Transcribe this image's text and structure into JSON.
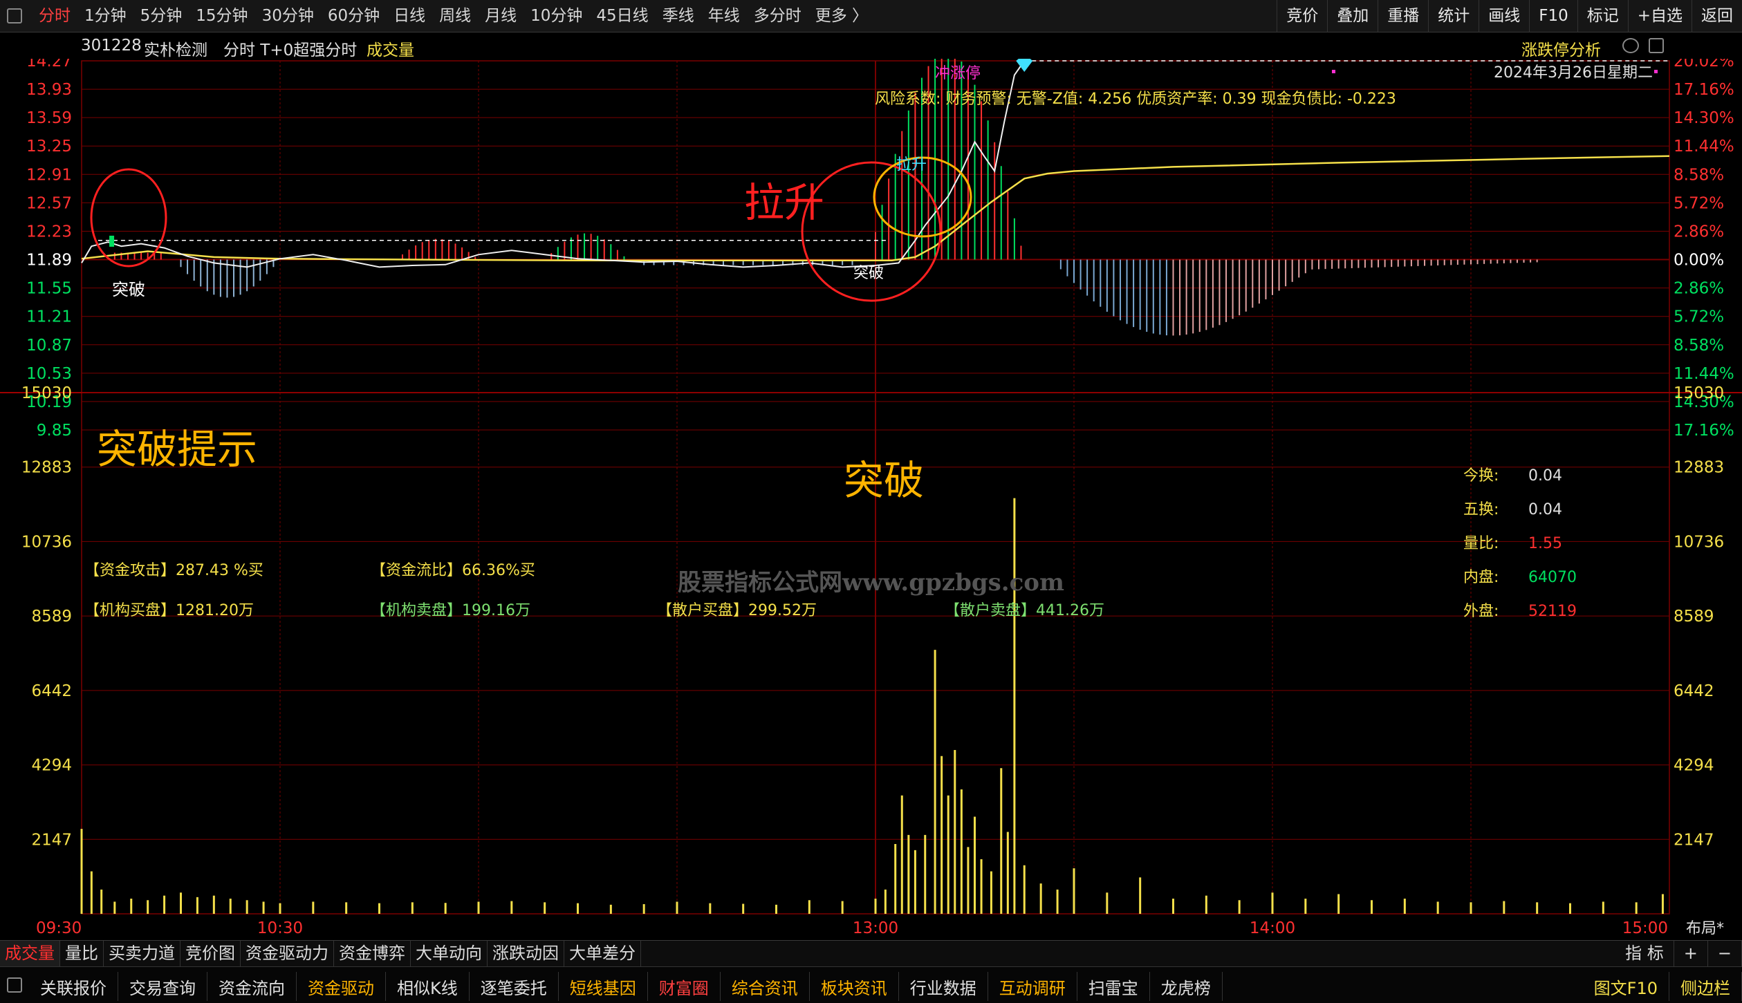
{
  "colors": {
    "up": "#ff3030",
    "down": "#00e060",
    "yellow": "#f5e04a",
    "white": "#f0f0f0",
    "grid": "#7a0000",
    "annot_orange": "#ffb400",
    "annot_red": "#ff2020",
    "cyan": "#40e0ff",
    "magenta": "#ff2fd0"
  },
  "toolbar": {
    "timeframes": [
      "分时",
      "1分钟",
      "5分钟",
      "15分钟",
      "30分钟",
      "60分钟",
      "日线",
      "周线",
      "月线",
      "10分钟",
      "45日线",
      "季线",
      "年线",
      "多分时",
      "更多 〉"
    ],
    "right": [
      "竞价",
      "叠加",
      "重播",
      "统计",
      "画线",
      "F10",
      "标记",
      "+自选",
      "返回"
    ]
  },
  "header": {
    "code": "301228",
    "name": "实朴检测",
    "mode": "分时 T+0超强分时",
    "volume_label": "成交量",
    "analysis": "涨跌停分析",
    "date": "2024年3月26日星期二"
  },
  "risk_line": "风险系数: 财务预警: 无警-Z值: 4.256 优质资产率: 0.39 现金负债比: -0.223",
  "annotations": {
    "breakout_hint": "突破提示",
    "breakout": "突破",
    "rise_big": "拉升",
    "rise_small": "拉升",
    "break_small_1": "突破",
    "break_small_2": "突破",
    "limit": "冲涨停"
  },
  "fund": {
    "attack": "【资金攻击】287.43 %买",
    "ratio": "【资金流比】66.36%买",
    "inst_buy": "【机构买盘】1281.20万",
    "inst_sell": "【机构卖盘】199.16万",
    "retail_buy": "【散户买盘】299.52万",
    "retail_sell": "【散户卖盘】441.26万"
  },
  "stats": [
    {
      "label": "今换:",
      "value": "0.04"
    },
    {
      "label": "五换:",
      "value": "0.04"
    },
    {
      "label": "量比:",
      "value": "1.55"
    },
    {
      "label": "内盘:",
      "value": "64070"
    },
    {
      "label": "外盘:",
      "value": "52119"
    }
  ],
  "watermark": "股票指标公式网www.gpzbgs.com",
  "chart_data": {
    "type": "line",
    "price_ticks": [
      "14.27",
      "13.93",
      "13.59",
      "13.25",
      "12.91",
      "12.57",
      "12.23",
      "11.89",
      "11.55",
      "11.21",
      "10.87",
      "10.53",
      "10.19",
      "9.85"
    ],
    "pct_ticks": [
      "20.02%",
      "17.16%",
      "14.30%",
      "11.44%",
      "8.58%",
      "5.72%",
      "2.86%",
      "0.00%",
      "2.86%",
      "5.72%",
      "8.58%",
      "11.44%",
      "14.30%",
      "17.16%"
    ],
    "volume_ticks": [
      "15030",
      "12883",
      "10736",
      "8589",
      "6442",
      "4294",
      "2147"
    ],
    "time_ticks": [
      "09:30",
      "10:30",
      "13:00",
      "14:00",
      "15:00"
    ],
    "layout_label": "布局*",
    "prev_close": 11.89,
    "ylim": [
      9.85,
      14.27
    ],
    "vol_ylim": [
      0,
      17177
    ],
    "price": [
      [
        0,
        11.85
      ],
      [
        3,
        12.05
      ],
      [
        8,
        12.1
      ],
      [
        12,
        12.05
      ],
      [
        18,
        12.08
      ],
      [
        25,
        12.03
      ],
      [
        32,
        11.93
      ],
      [
        40,
        11.85
      ],
      [
        50,
        11.8
      ],
      [
        60,
        11.9
      ],
      [
        70,
        11.95
      ],
      [
        80,
        11.88
      ],
      [
        90,
        11.8
      ],
      [
        100,
        11.82
      ],
      [
        110,
        11.83
      ],
      [
        120,
        11.95
      ],
      [
        130,
        12.0
      ],
      [
        140,
        11.95
      ],
      [
        150,
        11.9
      ],
      [
        160,
        11.88
      ],
      [
        170,
        11.86
      ],
      [
        180,
        11.87
      ],
      [
        190,
        11.83
      ],
      [
        200,
        11.8
      ],
      [
        210,
        11.82
      ],
      [
        220,
        11.85
      ],
      [
        230,
        11.8
      ],
      [
        240,
        11.82
      ],
      [
        247,
        11.85
      ],
      [
        252,
        12.12
      ],
      [
        255,
        12.3
      ],
      [
        258,
        12.45
      ],
      [
        262,
        12.65
      ],
      [
        266,
        12.95
      ],
      [
        270,
        13.3
      ],
      [
        273,
        13.12
      ],
      [
        276,
        12.95
      ],
      [
        279,
        13.55
      ],
      [
        282,
        14.1
      ],
      [
        285,
        14.27
      ]
    ],
    "avg": [
      [
        0,
        11.9
      ],
      [
        20,
        11.99
      ],
      [
        40,
        11.92
      ],
      [
        60,
        11.9
      ],
      [
        100,
        11.89
      ],
      [
        150,
        11.88
      ],
      [
        200,
        11.88
      ],
      [
        245,
        11.88
      ],
      [
        252,
        11.92
      ],
      [
        258,
        12.05
      ],
      [
        266,
        12.3
      ],
      [
        275,
        12.58
      ],
      [
        285,
        12.86
      ],
      [
        292,
        12.92
      ],
      [
        300,
        12.95
      ],
      [
        330,
        13.0
      ],
      [
        380,
        13.05
      ],
      [
        440,
        13.1
      ],
      [
        480,
        13.13
      ]
    ],
    "volume": [
      [
        0,
        2800
      ],
      [
        3,
        1400
      ],
      [
        6,
        800
      ],
      [
        10,
        400
      ],
      [
        15,
        500
      ],
      [
        20,
        450
      ],
      [
        25,
        600
      ],
      [
        30,
        700
      ],
      [
        35,
        550
      ],
      [
        40,
        600
      ],
      [
        45,
        500
      ],
      [
        50,
        450
      ],
      [
        55,
        400
      ],
      [
        60,
        350
      ],
      [
        70,
        400
      ],
      [
        80,
        380
      ],
      [
        90,
        350
      ],
      [
        100,
        380
      ],
      [
        110,
        360
      ],
      [
        120,
        400
      ],
      [
        130,
        420
      ],
      [
        140,
        380
      ],
      [
        150,
        350
      ],
      [
        160,
        300
      ],
      [
        170,
        320
      ],
      [
        180,
        400
      ],
      [
        190,
        350
      ],
      [
        200,
        330
      ],
      [
        210,
        300
      ],
      [
        220,
        450
      ],
      [
        230,
        420
      ],
      [
        240,
        500
      ],
      [
        243,
        800
      ],
      [
        246,
        2300
      ],
      [
        248,
        3900
      ],
      [
        250,
        2600
      ],
      [
        252,
        2100
      ],
      [
        255,
        2600
      ],
      [
        258,
        8700
      ],
      [
        260,
        5200
      ],
      [
        262,
        3900
      ],
      [
        264,
        5400
      ],
      [
        266,
        4100
      ],
      [
        268,
        2200
      ],
      [
        270,
        3200
      ],
      [
        272,
        1800
      ],
      [
        275,
        1400
      ],
      [
        278,
        4800
      ],
      [
        280,
        2700
      ],
      [
        282,
        13700
      ],
      [
        285,
        1600
      ],
      [
        290,
        1000
      ],
      [
        295,
        800
      ],
      [
        300,
        1500
      ],
      [
        310,
        700
      ],
      [
        320,
        1200
      ],
      [
        330,
        500
      ],
      [
        340,
        600
      ],
      [
        350,
        450
      ],
      [
        360,
        700
      ],
      [
        370,
        500
      ],
      [
        380,
        650
      ],
      [
        390,
        450
      ],
      [
        400,
        500
      ],
      [
        410,
        400
      ],
      [
        420,
        380
      ],
      [
        430,
        420
      ],
      [
        440,
        380
      ],
      [
        450,
        350
      ],
      [
        460,
        400
      ],
      [
        470,
        380
      ],
      [
        478,
        650
      ]
    ]
  }
}
